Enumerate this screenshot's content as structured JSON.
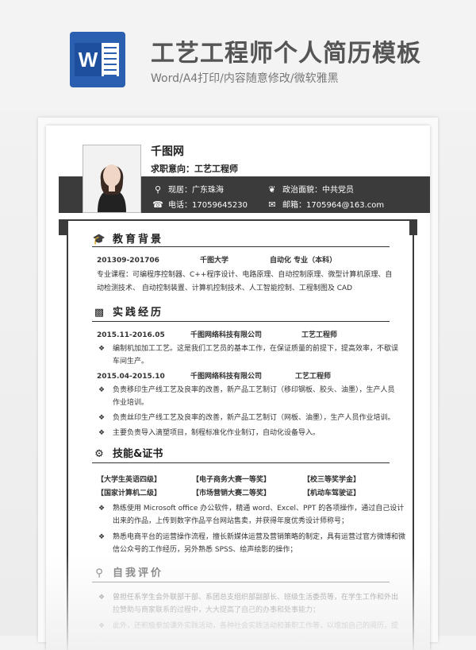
{
  "header": {
    "title": "工艺工程师个人简历模板",
    "subtitle": "Word/A4打印/内容随意修改/微软雅黑",
    "icon_letter": "W"
  },
  "resume": {
    "name": "千图网",
    "objective": "求职意向：工艺工程师",
    "location": "现居：广东珠海",
    "phone": "电话：17059645230",
    "politics": "政治面貌：中共党员",
    "email": "邮箱：1705964@163.com"
  },
  "education": {
    "title": "教育背景",
    "period": "201309-201706",
    "school": "千图大学",
    "major": "自动化 专业（本科）",
    "courses_line1": "专业课程：可编程序控制器、C++程序设计、电路原理、自动控制原理、微型计算机原理、自",
    "courses_line2": "动检测技术、 自动控制装置、计算机控制技术、人工智能控制、工程制图及 CAD"
  },
  "experience": {
    "title": "实践经历",
    "job1": {
      "period": "2015.11-2016.05",
      "company": "千图网络科技有限公司",
      "role": "工艺工程师",
      "line1": "编制机加加工工艺。这是我们工艺员的基本工作，在保证质量的前提下，提高效率，不歇误",
      "line2": "车间生产。"
    },
    "job2": {
      "period": "2015.04-2015.10",
      "company": "千图网络科技有限公司",
      "role": "工艺工程师",
      "b1_line1": "负责移印生产线工艺及良率的改善，新产品工艺制订（移印钢板、胶头、油墨），生产人员",
      "b1_line2": "作业培训。",
      "b2": "负责丝印生产线工艺及良率的改善，新产品工艺制订（网板、油墨），生产人员作业培训。",
      "b3": "主要负责导入滴塑项目，制程标准化作业制订，自动化设备导入。"
    }
  },
  "skills": {
    "title": "技能&证书",
    "certs": [
      "【大学生英语四级】",
      "【电子商务大赛一等奖】",
      "【校三等奖学金】",
      "【国家计算机二级】",
      "【市场营销大赛二等奖】",
      "【机动车驾驶证】"
    ],
    "b1_line1": "熟练使用 Microsoft office 办公软件，精通 word、Excel、PPT 的各项操作，通过自己设计",
    "b1_line2": "出来的作品，上传到数字作品平台网站售卖，并获得年度优秀设计师称号；",
    "b2_line1": "熟悉电商平台的运营操作流程，擅长新媒体运营及营销策略的制定，具有运营过官方微博和微",
    "b2_line2": "信公众号的工作经历，另外熟悉 SPSS、绘声绘影的操作；"
  },
  "self_eval": {
    "title": "自我评价",
    "line1": "曾担任系学生会外联部干部、系团总支组织部副部长、班级生活委员等，在学生工作和外出",
    "line2": "拉赞助与商家联系的过程中，大大提高了自己的办事和处事能力；",
    "line3": "此外，还积极参加课外实践活动，各种社会实践活动和兼职工作等，以增加自己的阅历，提"
  },
  "colors": {
    "dark_bar": "#3b3b3b",
    "word_blue": "#2b5fb0"
  }
}
